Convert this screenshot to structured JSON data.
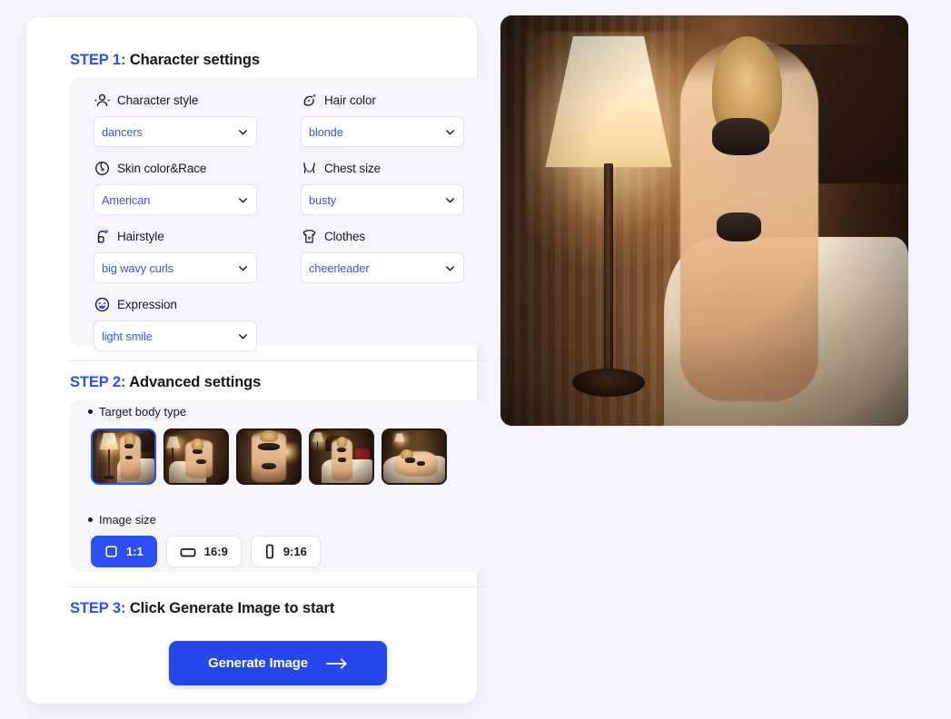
{
  "steps": {
    "step1": {
      "num": "STEP 1:",
      "title": " Character settings"
    },
    "step2": {
      "num": "STEP 2:",
      "title": " Advanced settings"
    },
    "step3": {
      "num": "STEP 3:",
      "title": " Click Generate Image to start"
    }
  },
  "fields": [
    {
      "label": "Character style",
      "icon": "character-style-icon",
      "value": "dancers"
    },
    {
      "label": "Hair color",
      "icon": "hair-color-icon",
      "value": "blonde"
    },
    {
      "label": "Skin color&Race",
      "icon": "globe-icon",
      "value": "American"
    },
    {
      "label": "Chest size",
      "icon": "chest-size-icon",
      "value": "busty"
    },
    {
      "label": "Hairstyle",
      "icon": "hairstyle-icon",
      "value": "big wavy curls"
    },
    {
      "label": "Clothes",
      "icon": "tshirt-icon",
      "value": "cheerleader"
    },
    {
      "label": "Expression",
      "icon": "smiley-icon",
      "value": "light smile"
    }
  ],
  "advanced": {
    "body_type_label": "Target body type",
    "image_size_label": "Image size",
    "thumbnails": [
      {
        "name": "body-type-1",
        "selected": true
      },
      {
        "name": "body-type-2",
        "selected": false
      },
      {
        "name": "body-type-3",
        "selected": false
      },
      {
        "name": "body-type-4",
        "selected": false
      },
      {
        "name": "body-type-5",
        "selected": false
      }
    ],
    "sizes": [
      {
        "label": "1:1",
        "icon": "square-icon",
        "active": true
      },
      {
        "label": "16:9",
        "icon": "landscape-icon",
        "active": false
      },
      {
        "label": "9:16",
        "icon": "portrait-icon",
        "active": false
      }
    ]
  },
  "generate": {
    "label": "Generate Image",
    "icon": "arrow-right-icon"
  },
  "preview": {
    "alt": "generated-character-preview"
  },
  "colors": {
    "accent": "#2b4ff0",
    "button": "#2546e8",
    "value_text": "#3b53ef",
    "page_bg": "#f4f5fb",
    "panel_bg": "#f5f6fa"
  }
}
